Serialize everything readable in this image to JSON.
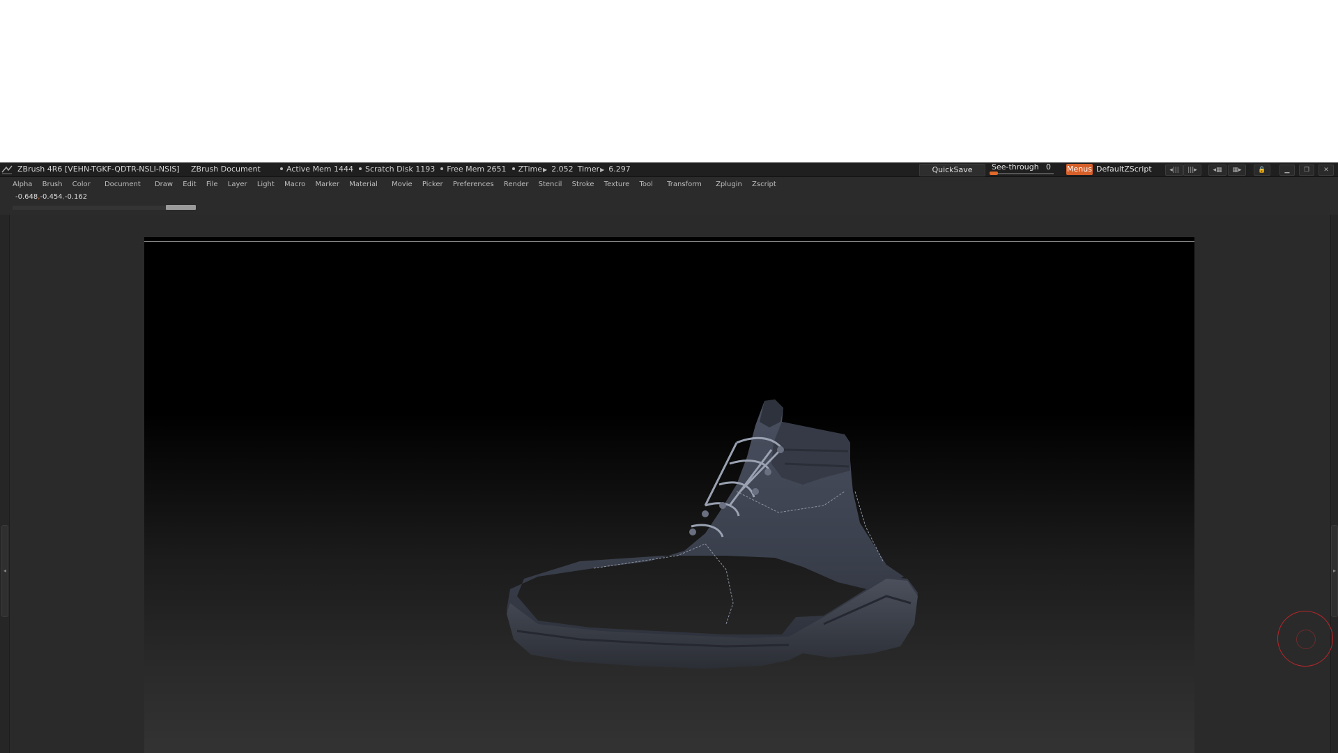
{
  "titlebar": {
    "app_title": "ZBrush 4R6 [VEHN-TGKF-QDTR-NSLI-NSIS]",
    "document_title": "ZBrush Document",
    "active_mem": "Active Mem 1444",
    "scratch_disk": "Scratch Disk 1193",
    "free_mem": "Free Mem 2651",
    "ztime_label": "ZTime",
    "ztime_value": "2.052",
    "timer_label": "Timer",
    "timer_value": "6.297"
  },
  "toolbar": {
    "quicksave_label": "QuickSave",
    "see_through_label": "See-through",
    "see_through_value": "0",
    "see_through_level": 0,
    "menus_label": "Menus",
    "script_label": "DefaultZScript"
  },
  "menu": {
    "items": [
      "Alpha",
      "Brush",
      "Color",
      "Document",
      "Draw",
      "Edit",
      "File",
      "Layer",
      "Light",
      "Macro",
      "Marker",
      "Material",
      "Movie",
      "Picker",
      "Preferences",
      "Render",
      "Stencil",
      "Stroke",
      "Texture",
      "Tool",
      "Transform",
      "Zplugin",
      "Zscript"
    ]
  },
  "status": {
    "x": "-0.648",
    "y": "-0.454",
    "z": "-0.162"
  },
  "colors": {
    "accent": "#e0682a",
    "ring": "#b8272b",
    "background": "#2b2b2b"
  },
  "icons": [
    "zbrush-logo-icon",
    "shelf-left-icon",
    "shelf-right-icon",
    "layout-icon",
    "layout-2-icon",
    "lock-icon",
    "minimize-icon",
    "restore-icon",
    "close-icon"
  ]
}
